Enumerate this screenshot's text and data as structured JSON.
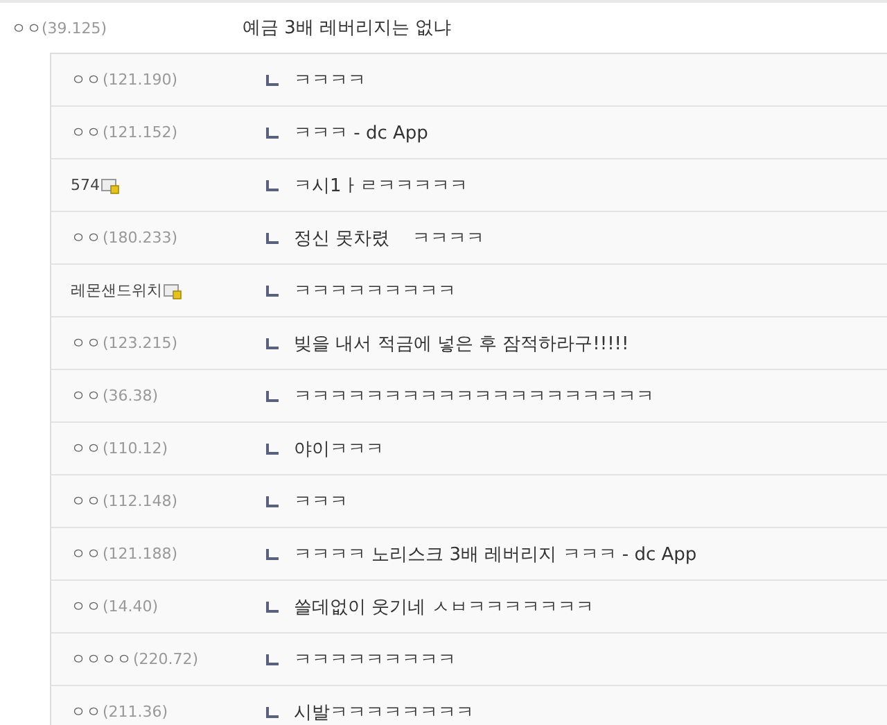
{
  "comment": {
    "nick": "ㅇㅇ",
    "ip": "(39.125)",
    "text": "예금 3배 레버리지는 없냐"
  },
  "replies": [
    {
      "nick": "ㅇㅇ",
      "ip": "(121.190)",
      "member": false,
      "text": "ㅋㅋㅋㅋ"
    },
    {
      "nick": "ㅇㅇ",
      "ip": "(121.152)",
      "member": false,
      "text": "ㅋㅋㅋ - dc App"
    },
    {
      "nick": "574",
      "member": true,
      "text": "ㅋ시1ㅏㄹㅋㅋㅋㅋㅋ"
    },
    {
      "nick": "ㅇㅇ",
      "ip": "(180.233)",
      "member": false,
      "text": "정신 못차렸    ㅋㅋㅋㅋ"
    },
    {
      "nick": "레몬샌드위치",
      "member": true,
      "text": "ㅋㅋㅋㅋㅋㅋㅋㅋㅋ"
    },
    {
      "nick": "ㅇㅇ",
      "ip": "(123.215)",
      "member": false,
      "text": "빚을 내서 적금에 넣은 후 잠적하라구!!!!!"
    },
    {
      "nick": "ㅇㅇ",
      "ip": "(36.38)",
      "member": false,
      "text": "ㅋㅋㅋㅋㅋㅋㅋㅋㅋㅋㅋㅋㅋㅋㅋㅋㅋㅋㅋㅋ"
    },
    {
      "nick": "ㅇㅇ",
      "ip": "(110.12)",
      "member": false,
      "text": "야이ㅋㅋㅋ"
    },
    {
      "nick": "ㅇㅇ",
      "ip": "(112.148)",
      "member": false,
      "text": "ㅋㅋㅋ"
    },
    {
      "nick": "ㅇㅇ",
      "ip": "(121.188)",
      "member": false,
      "text": "ㅋㅋㅋㅋ 노리스크 3배 레버리지 ㅋㅋㅋ - dc App"
    },
    {
      "nick": "ㅇㅇ",
      "ip": "(14.40)",
      "member": false,
      "text": "쓸데없이 웃기네 ㅅㅂㅋㅋㅋㅋㅋㅋㅋ"
    },
    {
      "nick": "ㅇㅇㅇㅇ",
      "ip": "(220.72)",
      "member": false,
      "text": "ㅋㅋㅋㅋㅋㅋㅋㅋㅋ"
    },
    {
      "nick": "ㅇㅇ",
      "ip": "(211.36)",
      "member": false,
      "text": "시발ㅋㅋㅋㅋㅋㅋㅋㅋ"
    }
  ]
}
